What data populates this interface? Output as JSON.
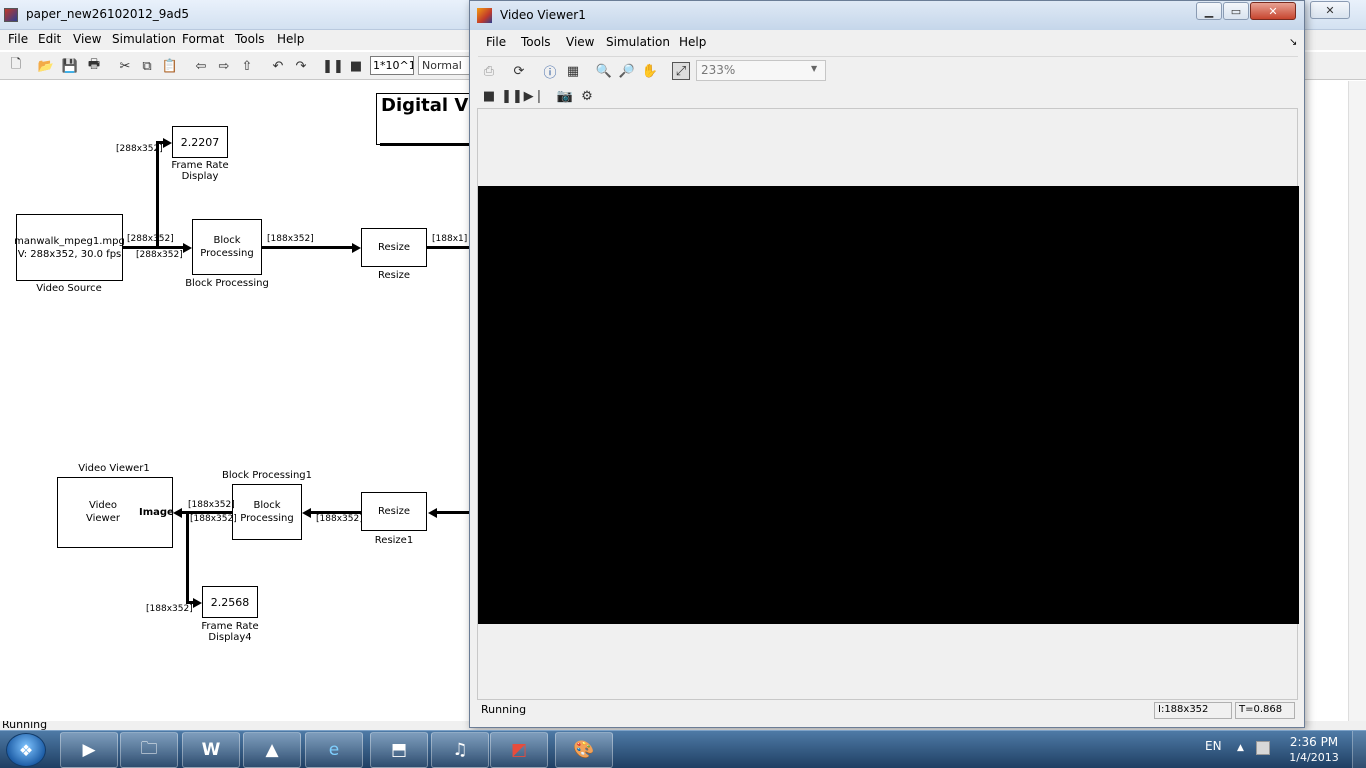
{
  "simulink": {
    "title": "paper_new26102012_9ad5",
    "menu": [
      "File",
      "Edit",
      "View",
      "Simulation",
      "Format",
      "Tools",
      "Help"
    ],
    "stop_time": "1*10^1",
    "sim_mode": "Normal",
    "annotation": "Digital Vid",
    "status": "Running",
    "blocks": {
      "frame_rate_display": {
        "value": "2.2207",
        "label_line1": "Frame Rate",
        "label_line2": "Display"
      },
      "video_source": {
        "line1": "manwalk_mpeg1.mpg",
        "line2": "V: 288x352, 30.0 fps",
        "label": "Video Source"
      },
      "block_processing": {
        "line1": "Block",
        "line2": "Processing",
        "label": "Block Processing"
      },
      "resize": {
        "text": "Resize",
        "label": "Resize"
      },
      "video_viewer": {
        "line1": "Video",
        "line2": "Viewer",
        "port": "Image",
        "label": "Video Viewer1"
      },
      "block_processing1": {
        "line1": "Block",
        "line2": "Processing",
        "label": "Block Processing1"
      },
      "resize1": {
        "text": "Resize",
        "label": "Resize1"
      },
      "frame_rate_display4": {
        "value": "2.2568",
        "label_line1": "Frame Rate",
        "label_line2": "Display4"
      }
    },
    "signals": {
      "s1": "[288x352]",
      "s2": "[288x352]",
      "s3": "[288x352]",
      "s4": "[188x352]",
      "s5": "[188x1]",
      "s6": "[188x352]",
      "s7": "[188x352]",
      "s8": "[188x352]",
      "s9": "[188x352]"
    }
  },
  "video_viewer": {
    "title": "Video Viewer1",
    "menu": [
      "File",
      "Tools",
      "View",
      "Simulation",
      "Help"
    ],
    "zoom": "233%",
    "status": "Running",
    "dims": "I:188x352",
    "time": "T=0.868"
  },
  "taskbar": {
    "language": "EN",
    "time": "2:36 PM",
    "date": "1/4/2013"
  },
  "colors": {
    "video_background": "#000000",
    "taskbar": "#2a4d74"
  }
}
